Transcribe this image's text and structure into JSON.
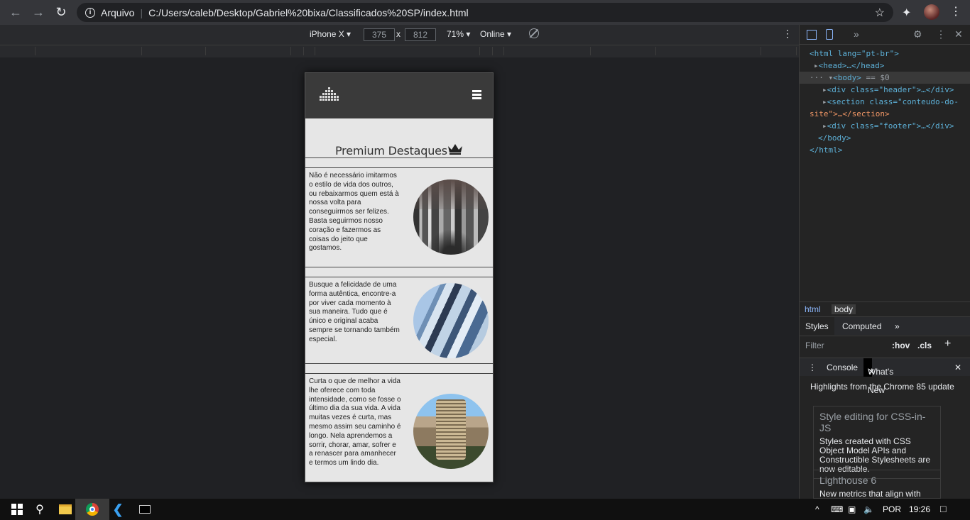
{
  "browser": {
    "address_scheme_label": "Arquivo",
    "url": "C:/Users/caleb/Desktop/Gabriel%20bixa/Classificados%20SP/index.html"
  },
  "device_toolbar": {
    "device": "iPhone X",
    "width": "375",
    "height": "812",
    "times": "x",
    "zoom": "71%",
    "network": "Online"
  },
  "site": {
    "section_title": "Premium Destaques",
    "cards": [
      {
        "text": "Não é necessário imitarmos o estilo de vida dos outros, ou rebaixarmos quem está à nossa volta para conseguirmos ser felizes. Basta seguirmos nosso coração e fazermos as coisas do jeito que gostamos."
      },
      {
        "text": "Busque a felicidade de uma forma autêntica, encontre-a por viver cada momento à sua maneira. Tudo que é único e original acaba sempre se tornando também especial."
      },
      {
        "text": "Curta o que de melhor a vida lhe oferece com toda intensidade, como se fosse o último dia da sua vida. A vida muitas vezes é curta, mas mesmo assim seu caminho é longo. Nela aprendemos a sorrir, chorar, amar, sofrer e a renascer para amanhecer e termos um lindo dia."
      }
    ]
  },
  "devtools": {
    "elements": {
      "html_open": "<html lang=\"pt-br\">",
      "head": "<head>…</head>",
      "body": "<body>",
      "body_eq": "== $0",
      "div_header": "<div class=\"header\">…</div>",
      "section_a": "<section class=\"conteudo-do-",
      "section_b": "site\">…</section>",
      "div_footer": "<div class=\"footer\">…</div>",
      "body_close": "</body>",
      "html_close": "</html>"
    },
    "breadcrumbs": [
      "html",
      "body"
    ],
    "panel_tabs": [
      "Styles",
      "Computed",
      "»"
    ],
    "filter_placeholder": "Filter",
    "filter_hov": ":hov",
    "filter_cls": ".cls",
    "drawer_tabs": [
      "Console",
      "What's New"
    ],
    "drawer_heading": "Highlights from the Chrome 85 update",
    "whats_new": [
      {
        "title": "Style editing for CSS-in-JS",
        "body": "Styles created with CSS Object Model APIs and Constructible Stylesheets are now editable."
      },
      {
        "title": "Lighthouse 6",
        "body": "New metrics that align with"
      }
    ]
  },
  "taskbar": {
    "lang": "POR",
    "time": "19:26"
  }
}
